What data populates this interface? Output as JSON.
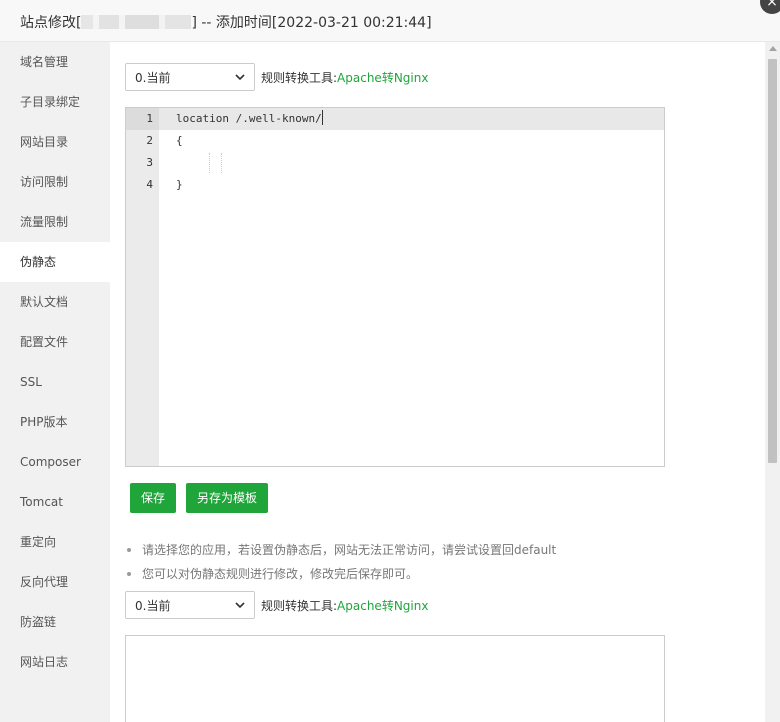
{
  "dialog": {
    "title_prefix": "站点修改[",
    "title_suffix": "] -- 添加时间[2022-03-21 00:21:44]",
    "close_glyph": "×"
  },
  "sidebar": {
    "items": [
      {
        "label": "域名管理"
      },
      {
        "label": "子目录绑定"
      },
      {
        "label": "网站目录"
      },
      {
        "label": "访问限制"
      },
      {
        "label": "流量限制"
      },
      {
        "label": "伪静态",
        "active": true
      },
      {
        "label": "默认文档"
      },
      {
        "label": "配置文件"
      },
      {
        "label": "SSL"
      },
      {
        "label": "PHP版本"
      },
      {
        "label": "Composer"
      },
      {
        "label": "Tomcat"
      },
      {
        "label": "重定向"
      },
      {
        "label": "反向代理"
      },
      {
        "label": "防盗链"
      },
      {
        "label": "网站日志"
      }
    ]
  },
  "rewrite": {
    "select_value": "0.当前",
    "tool_label": "规则转换工具:",
    "tool_link": "Apache转Nginx",
    "editor": {
      "line_numbers": [
        "1",
        "2",
        "3",
        "4"
      ],
      "lines": [
        "location /.well-known/",
        "{",
        "",
        "}"
      ],
      "active_line": 1
    },
    "save_button": "保存",
    "save_template_button": "另存为模板",
    "tips": [
      "请选择您的应用，若设置伪静态后，网站无法正常访问，请尝试设置回default",
      "您可以对伪静态规则进行修改，修改完后保存即可。"
    ],
    "select_value_2": "0.当前",
    "tool_label_2": "规则转换工具:",
    "tool_link_2": "Apache转Nginx"
  },
  "colors": {
    "accent": "#20a53a",
    "sidebar_bg": "#f1f1f1",
    "gutter_bg": "#ebebeb"
  },
  "icons": {
    "select_arrow": "chevron-down-icon",
    "close": "close-icon",
    "scroll_up": "arrow-up-icon"
  }
}
